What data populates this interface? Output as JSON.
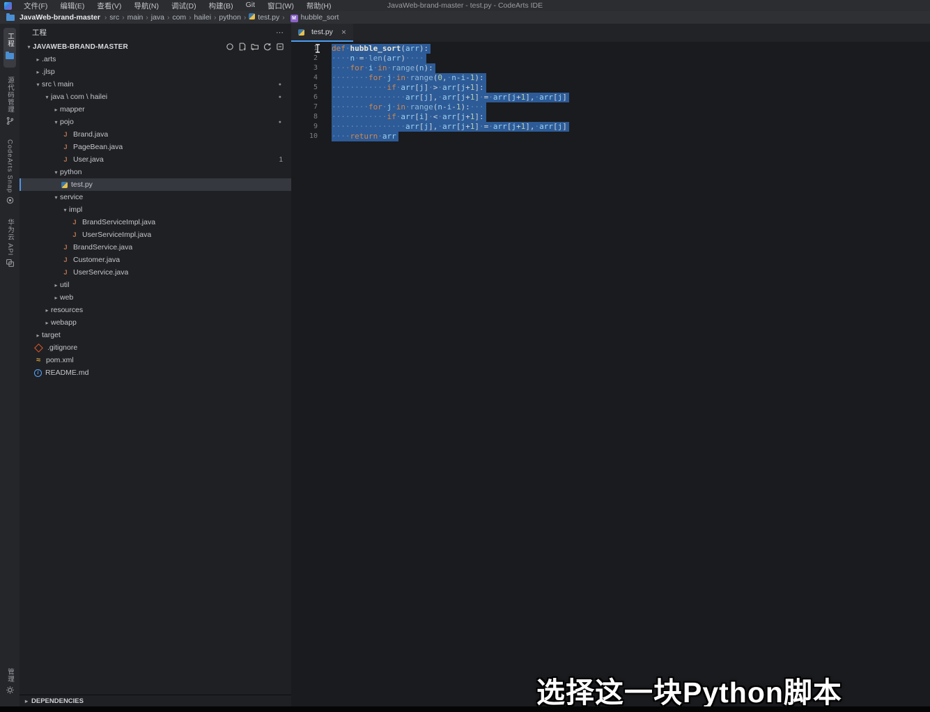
{
  "colors": {
    "selection": "#2d5b97",
    "accent": "#4c9df3",
    "caption": "#ffffff"
  },
  "icons": {
    "chevron_right": "›",
    "arrow_expanded": "▾",
    "arrow_collapsed": "▸",
    "close": "×",
    "more": "⋯",
    "dot": "●"
  },
  "window": {
    "title": "JavaWeb-brand-master - test.py - CodeArts IDE"
  },
  "menu": {
    "items": [
      "文件(F)",
      "编辑(E)",
      "查看(V)",
      "导航(N)",
      "调试(D)",
      "构建(B)",
      "Git",
      "窗口(W)",
      "帮助(H)"
    ]
  },
  "breadcrumb": {
    "project": "JavaWeb-brand-master",
    "path": [
      "src",
      "main",
      "java",
      "com",
      "hailei",
      "python"
    ],
    "file": "test.py",
    "symbol": "hubble_sort"
  },
  "activity_bar": {
    "items": [
      {
        "label": "工程",
        "icon": "folder-icon",
        "active": true
      },
      {
        "label": "源代码管理",
        "icon": "source-control-icon",
        "active": false
      },
      {
        "label": "CodeArts Snap",
        "icon": "snap-icon",
        "active": false
      },
      {
        "label": "华为云 API",
        "icon": "api-icon",
        "active": false
      }
    ],
    "bottom": {
      "label": "管理",
      "icon": "gear-icon"
    }
  },
  "sidebar": {
    "header": {
      "title": "工程",
      "more": "⋯"
    },
    "root_toolbar": [
      "sync-icon",
      "new-file-icon",
      "new-folder-icon",
      "refresh-icon",
      "collapse-all-icon"
    ],
    "tree": [
      {
        "label": "JAVAWEB-BRAND-MASTER",
        "level": 0,
        "kind": "root",
        "state": "expanded"
      },
      {
        "label": ".arts",
        "level": 1,
        "kind": "folder",
        "state": "collapsed"
      },
      {
        "label": ".jlsp",
        "level": 1,
        "kind": "folder",
        "state": "collapsed"
      },
      {
        "label": "src \\ main",
        "level": 1,
        "kind": "folder",
        "state": "expanded",
        "dot": true
      },
      {
        "label": "java \\ com \\ hailei",
        "level": 2,
        "kind": "folder",
        "state": "expanded",
        "dot": true
      },
      {
        "label": "mapper",
        "level": 3,
        "kind": "folder",
        "state": "collapsed"
      },
      {
        "label": "pojo",
        "level": 3,
        "kind": "folder",
        "state": "expanded",
        "dot": true
      },
      {
        "label": "Brand.java",
        "level": 4,
        "kind": "file",
        "icon": "java"
      },
      {
        "label": "PageBean.java",
        "level": 4,
        "kind": "file",
        "icon": "java"
      },
      {
        "label": "User.java",
        "level": 4,
        "kind": "file",
        "icon": "java",
        "badge": "1"
      },
      {
        "label": "python",
        "level": 3,
        "kind": "folder",
        "state": "expanded"
      },
      {
        "label": "test.py",
        "level": 4,
        "kind": "file",
        "icon": "python",
        "selected": true
      },
      {
        "label": "service",
        "level": 3,
        "kind": "folder",
        "state": "expanded"
      },
      {
        "label": "impl",
        "level": 4,
        "kind": "folder",
        "state": "expanded"
      },
      {
        "label": "BrandServiceImpl.java",
        "level": 5,
        "kind": "file",
        "icon": "java"
      },
      {
        "label": "UserServiceImpl.java",
        "level": 5,
        "kind": "file",
        "icon": "java"
      },
      {
        "label": "BrandService.java",
        "level": 4,
        "kind": "file",
        "icon": "java"
      },
      {
        "label": "Customer.java",
        "level": 4,
        "kind": "file",
        "icon": "java"
      },
      {
        "label": "UserService.java",
        "level": 4,
        "kind": "file",
        "icon": "java"
      },
      {
        "label": "util",
        "level": 3,
        "kind": "folder",
        "state": "collapsed"
      },
      {
        "label": "web",
        "level": 3,
        "kind": "folder",
        "state": "collapsed"
      },
      {
        "label": "resources",
        "level": 2,
        "kind": "folder",
        "state": "collapsed"
      },
      {
        "label": "webapp",
        "level": 2,
        "kind": "folder",
        "state": "collapsed"
      },
      {
        "label": "target",
        "level": 1,
        "kind": "folder",
        "state": "collapsed"
      },
      {
        "label": ".gitignore",
        "level": 1,
        "kind": "file",
        "icon": "git"
      },
      {
        "label": "pom.xml",
        "level": 1,
        "kind": "file",
        "icon": "xml"
      },
      {
        "label": "README.md",
        "level": 1,
        "kind": "file",
        "icon": "info"
      }
    ],
    "dependencies_label": "DEPENDENCIES"
  },
  "editor": {
    "tab": {
      "label": "test.py"
    },
    "code_lines": [
      {
        "tokens": [
          [
            "kw",
            "def"
          ],
          [
            "ws",
            "·"
          ],
          [
            "fn",
            "hubble_sort"
          ],
          [
            "pu",
            "("
          ],
          [
            "va",
            "arr"
          ],
          [
            "pu",
            "):"
          ]
        ]
      },
      {
        "tokens": [
          [
            "ws",
            "····"
          ],
          [
            "va",
            "n"
          ],
          [
            "ws",
            "·"
          ],
          [
            "pu",
            "="
          ],
          [
            "ws",
            "·"
          ],
          [
            "bi",
            "len"
          ],
          [
            "pu",
            "("
          ],
          [
            "va",
            "arr"
          ],
          [
            "pu",
            ")"
          ],
          [
            "ws",
            "····"
          ]
        ]
      },
      {
        "tokens": [
          [
            "ws",
            "····"
          ],
          [
            "kw",
            "for"
          ],
          [
            "ws",
            "·"
          ],
          [
            "va",
            "i"
          ],
          [
            "ws",
            "·"
          ],
          [
            "kw",
            "in"
          ],
          [
            "ws",
            "·"
          ],
          [
            "bi",
            "range"
          ],
          [
            "pu",
            "("
          ],
          [
            "va",
            "n"
          ],
          [
            "pu",
            "):"
          ]
        ]
      },
      {
        "tokens": [
          [
            "ws",
            "········"
          ],
          [
            "kw",
            "for"
          ],
          [
            "ws",
            "·"
          ],
          [
            "va",
            "j"
          ],
          [
            "ws",
            "·"
          ],
          [
            "kw",
            "in"
          ],
          [
            "ws",
            "·"
          ],
          [
            "bi",
            "range"
          ],
          [
            "pu",
            "("
          ],
          [
            "nu",
            "0"
          ],
          [
            "pu",
            ","
          ],
          [
            "ws",
            "·"
          ],
          [
            "va",
            "n"
          ],
          [
            "pu",
            "-"
          ],
          [
            "va",
            "i"
          ],
          [
            "pu",
            "-"
          ],
          [
            "nu",
            "1"
          ],
          [
            "pu",
            "):"
          ]
        ]
      },
      {
        "tokens": [
          [
            "ws",
            "············"
          ],
          [
            "kw",
            "if"
          ],
          [
            "ws",
            "·"
          ],
          [
            "va",
            "arr"
          ],
          [
            "pu",
            "["
          ],
          [
            "va",
            "j"
          ],
          [
            "pu",
            "]"
          ],
          [
            "ws",
            "·"
          ],
          [
            "pu",
            ">"
          ],
          [
            "ws",
            "·"
          ],
          [
            "va",
            "arr"
          ],
          [
            "pu",
            "["
          ],
          [
            "va",
            "j"
          ],
          [
            "pu",
            "+"
          ],
          [
            "nu",
            "1"
          ],
          [
            "pu",
            "]:"
          ]
        ]
      },
      {
        "tokens": [
          [
            "ws",
            "················"
          ],
          [
            "va",
            "arr"
          ],
          [
            "pu",
            "["
          ],
          [
            "va",
            "j"
          ],
          [
            "pu",
            "],"
          ],
          [
            "ws",
            "·"
          ],
          [
            "va",
            "arr"
          ],
          [
            "pu",
            "["
          ],
          [
            "va",
            "j"
          ],
          [
            "pu",
            "+"
          ],
          [
            "nu",
            "1"
          ],
          [
            "pu",
            "]"
          ],
          [
            "ws",
            "·"
          ],
          [
            "pu",
            "="
          ],
          [
            "ws",
            "·"
          ],
          [
            "va",
            "arr"
          ],
          [
            "pu",
            "["
          ],
          [
            "va",
            "j"
          ],
          [
            "pu",
            "+"
          ],
          [
            "nu",
            "1"
          ],
          [
            "pu",
            "],"
          ],
          [
            "ws",
            "·"
          ],
          [
            "va",
            "arr"
          ],
          [
            "pu",
            "["
          ],
          [
            "va",
            "j"
          ],
          [
            "pu",
            "]"
          ]
        ]
      },
      {
        "tokens": [
          [
            "ws",
            "········"
          ],
          [
            "kw",
            "for"
          ],
          [
            "ws",
            "·"
          ],
          [
            "va",
            "j"
          ],
          [
            "ws",
            "·"
          ],
          [
            "kw",
            "in"
          ],
          [
            "ws",
            "·"
          ],
          [
            "bi",
            "range"
          ],
          [
            "pu",
            "("
          ],
          [
            "va",
            "n"
          ],
          [
            "pu",
            "-"
          ],
          [
            "va",
            "i"
          ],
          [
            "pu",
            "-"
          ],
          [
            "nu",
            "1"
          ],
          [
            "pu",
            "):"
          ],
          [
            "ws",
            "···"
          ]
        ]
      },
      {
        "tokens": [
          [
            "ws",
            "············"
          ],
          [
            "kw",
            "if"
          ],
          [
            "ws",
            "·"
          ],
          [
            "va",
            "arr"
          ],
          [
            "pu",
            "["
          ],
          [
            "va",
            "i"
          ],
          [
            "pu",
            "]"
          ],
          [
            "ws",
            "·"
          ],
          [
            "pu",
            "<"
          ],
          [
            "ws",
            "·"
          ],
          [
            "va",
            "arr"
          ],
          [
            "pu",
            "["
          ],
          [
            "va",
            "j"
          ],
          [
            "pu",
            "+"
          ],
          [
            "nu",
            "1"
          ],
          [
            "pu",
            "]:"
          ]
        ]
      },
      {
        "tokens": [
          [
            "ws",
            "················"
          ],
          [
            "va",
            "arr"
          ],
          [
            "pu",
            "["
          ],
          [
            "va",
            "j"
          ],
          [
            "pu",
            "],"
          ],
          [
            "ws",
            "·"
          ],
          [
            "va",
            "arr"
          ],
          [
            "pu",
            "["
          ],
          [
            "va",
            "j"
          ],
          [
            "pu",
            "+"
          ],
          [
            "nu",
            "1"
          ],
          [
            "pu",
            "]"
          ],
          [
            "ws",
            "·"
          ],
          [
            "pu",
            "="
          ],
          [
            "ws",
            "·"
          ],
          [
            "va",
            "arr"
          ],
          [
            "pu",
            "["
          ],
          [
            "va",
            "j"
          ],
          [
            "pu",
            "+"
          ],
          [
            "nu",
            "1"
          ],
          [
            "pu",
            "],"
          ],
          [
            "ws",
            "·"
          ],
          [
            "va",
            "arr"
          ],
          [
            "pu",
            "["
          ],
          [
            "va",
            "j"
          ],
          [
            "pu",
            "]"
          ]
        ]
      },
      {
        "tokens": [
          [
            "ws",
            "····"
          ],
          [
            "kw",
            "return"
          ],
          [
            "ws",
            "·"
          ],
          [
            "va",
            "arr"
          ]
        ]
      }
    ]
  },
  "caption": {
    "text": "选择这一块Python脚本"
  }
}
